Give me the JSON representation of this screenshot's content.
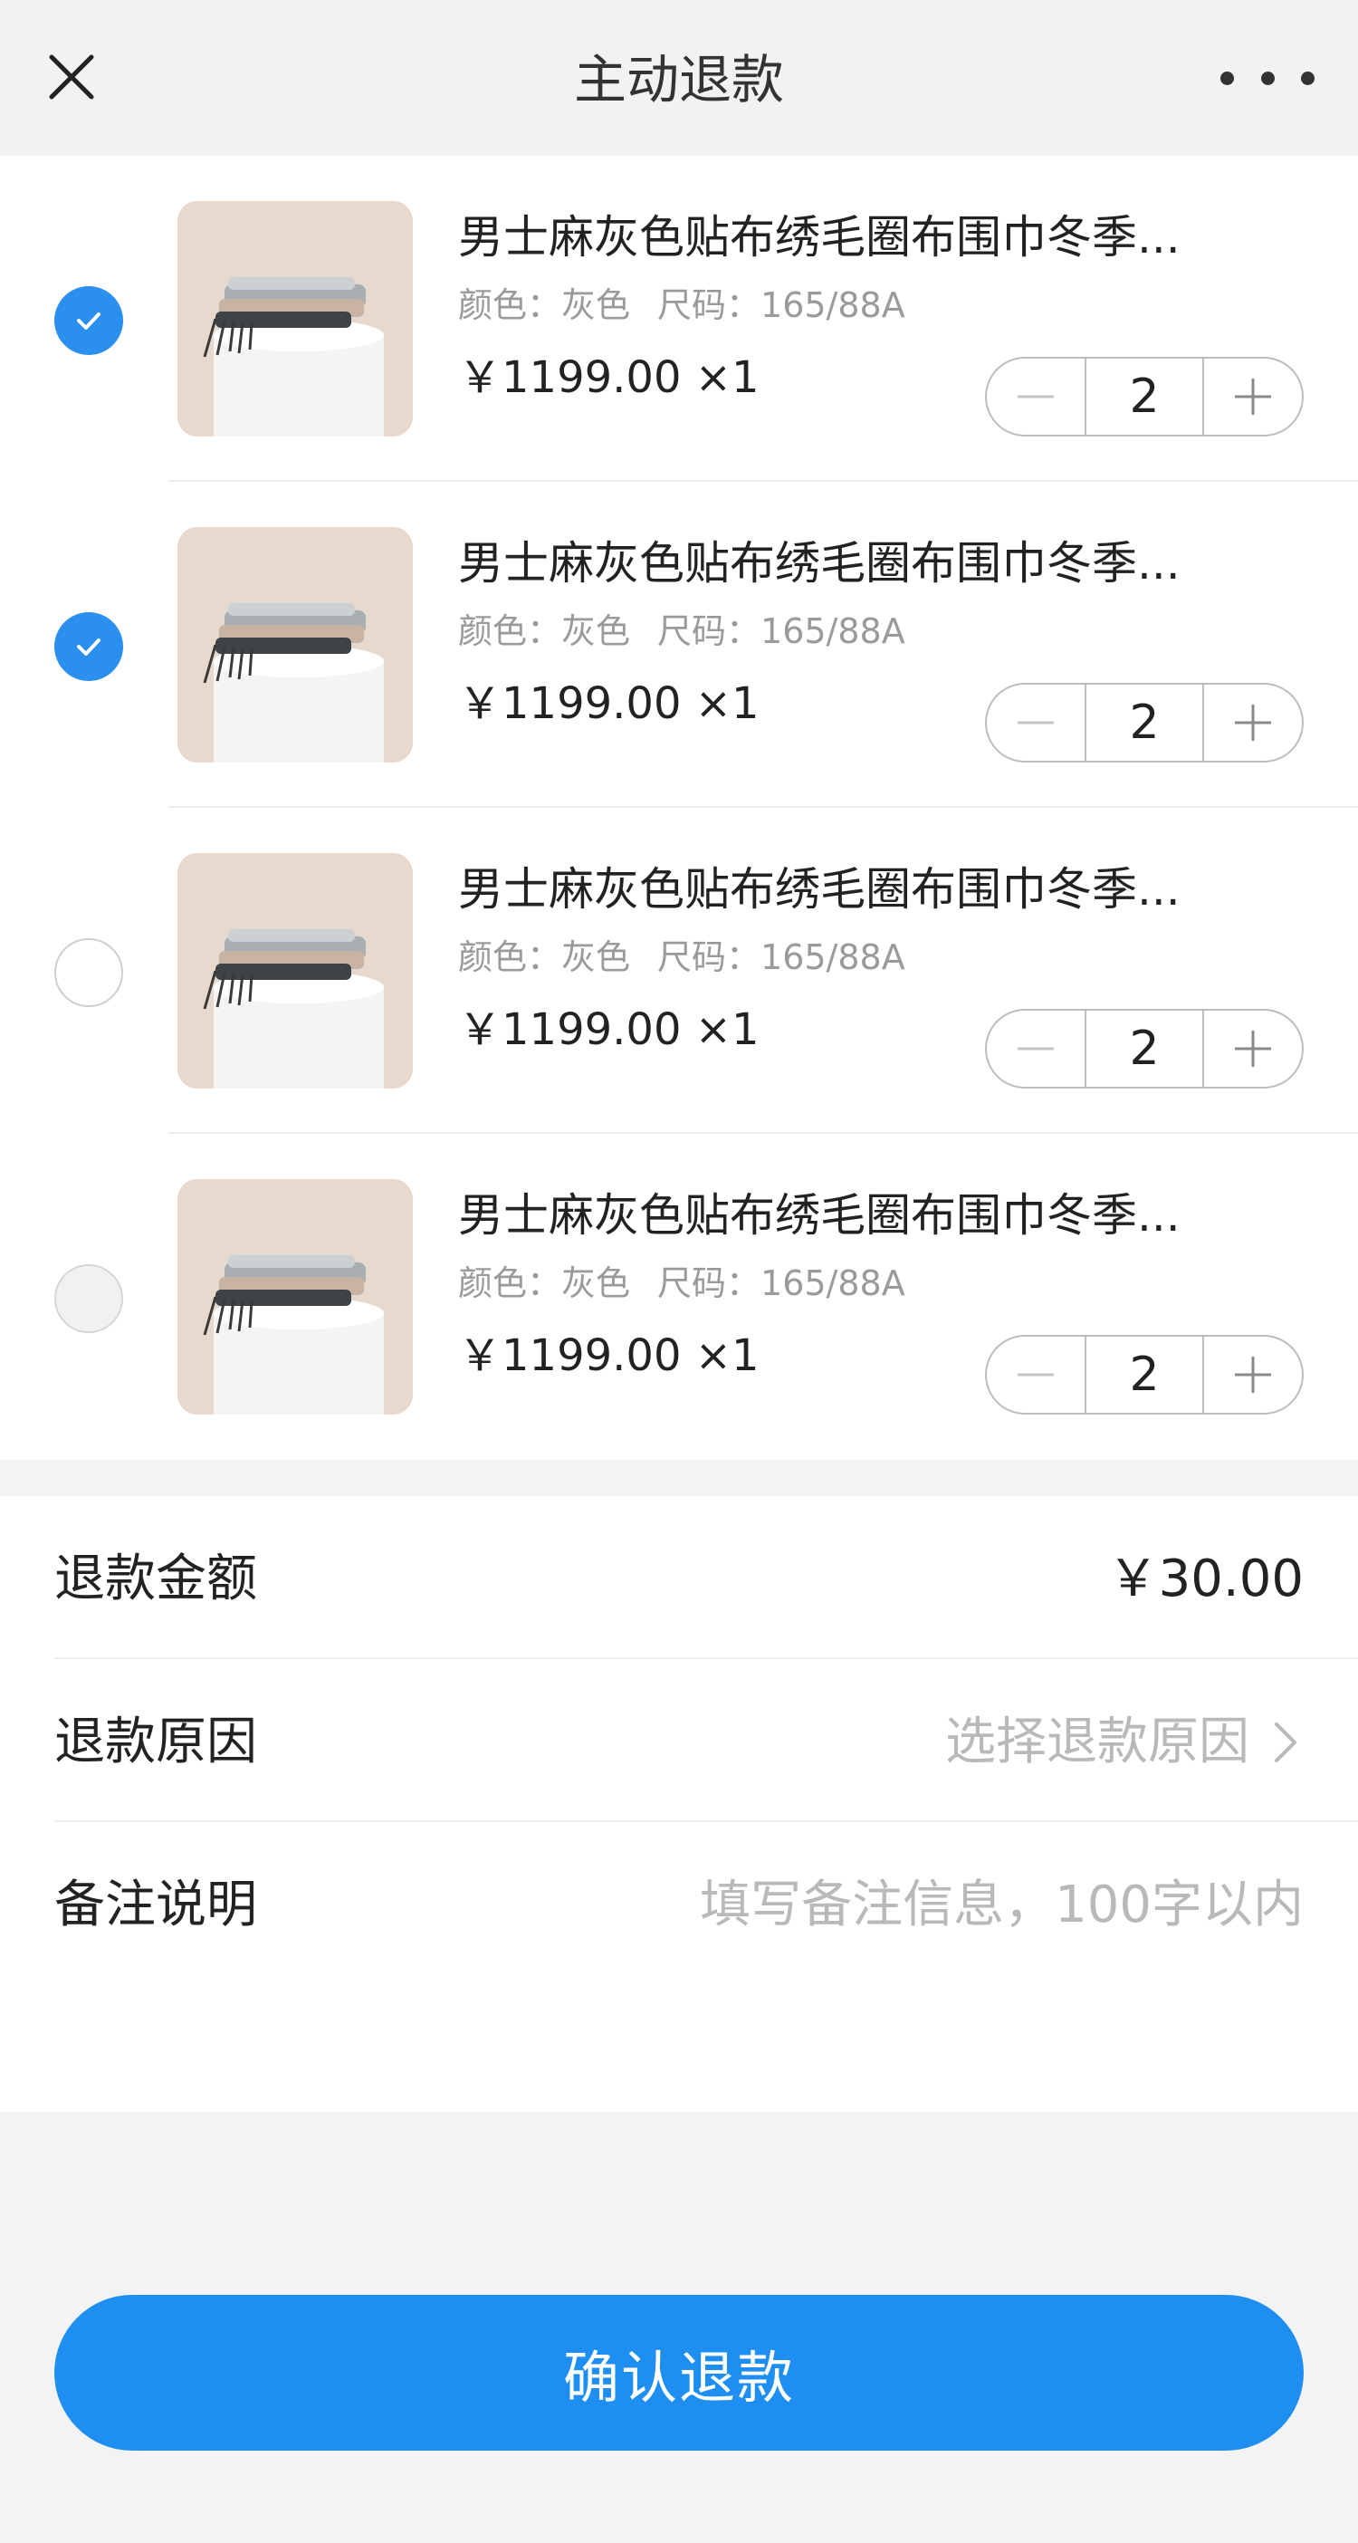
{
  "header": {
    "title": "主动退款",
    "close_icon": "close-icon",
    "more_icon": "more-icon"
  },
  "items": [
    {
      "name": "男士麻灰色贴布绣毛圈布围巾冬季...",
      "spec_color": "颜色：灰色",
      "spec_size": "尺码：165/88A",
      "price": "￥1199.00 ×1",
      "qty": "2",
      "checked": "checked"
    },
    {
      "name": "男士麻灰色贴布绣毛圈布围巾冬季...",
      "spec_color": "颜色：灰色",
      "spec_size": "尺码：165/88A",
      "price": "￥1199.00 ×1",
      "qty": "2",
      "checked": "checked"
    },
    {
      "name": "男士麻灰色贴布绣毛圈布围巾冬季...",
      "spec_color": "颜色：灰色",
      "spec_size": "尺码：165/88A",
      "price": "￥1199.00 ×1",
      "qty": "2",
      "checked": "unchecked"
    },
    {
      "name": "男士麻灰色贴布绣毛圈布围巾冬季...",
      "spec_color": "颜色：灰色",
      "spec_size": "尺码：165/88A",
      "price": "￥1199.00 ×1",
      "qty": "2",
      "checked": "disabled"
    }
  ],
  "form": {
    "amount_label": "退款金额",
    "amount_value": "￥30.00",
    "reason_label": "退款原因",
    "reason_placeholder": "选择退款原因",
    "note_label": "备注说明",
    "note_placeholder": "填写备注信息，100字以内"
  },
  "confirm_label": "确认退款",
  "colors": {
    "accent": "#1e8ff0",
    "check_on": "#2b8ff0",
    "page_bg": "#f3f3f3"
  }
}
